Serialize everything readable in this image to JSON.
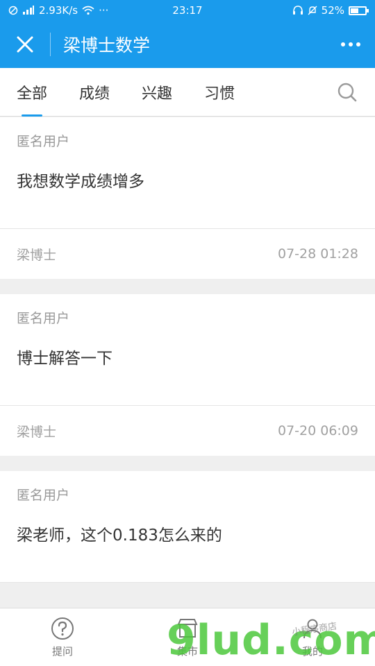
{
  "status_bar": {
    "network_speed": "2.93K/s",
    "dots": "···",
    "time": "23:17",
    "battery_percent": "52%",
    "battery_level": 0.52
  },
  "header": {
    "title": "梁博士数学"
  },
  "tabs": [
    {
      "label": "全部",
      "active": true
    },
    {
      "label": "成绩",
      "active": false
    },
    {
      "label": "兴趣",
      "active": false
    },
    {
      "label": "习惯",
      "active": false
    }
  ],
  "posts": [
    {
      "author": "匿名用户",
      "text": "我想数学成绩增多",
      "replier": "梁博士",
      "timestamp": "07-28 01:28"
    },
    {
      "author": "匿名用户",
      "text": "博士解答一下",
      "replier": "梁博士",
      "timestamp": "07-20 06:09"
    },
    {
      "author": "匿名用户",
      "text": "梁老师，这个0.183怎么来的",
      "replier": "",
      "timestamp": ""
    }
  ],
  "bottom_nav": [
    {
      "label": "提问",
      "icon": "question-icon"
    },
    {
      "label": "集市",
      "icon": "store-icon"
    },
    {
      "label": "我的",
      "icon": "user-icon"
    }
  ],
  "watermark": {
    "brand": "9lud.com",
    "sub": "小程序商店"
  },
  "colors": {
    "accent": "#1a9bec"
  }
}
